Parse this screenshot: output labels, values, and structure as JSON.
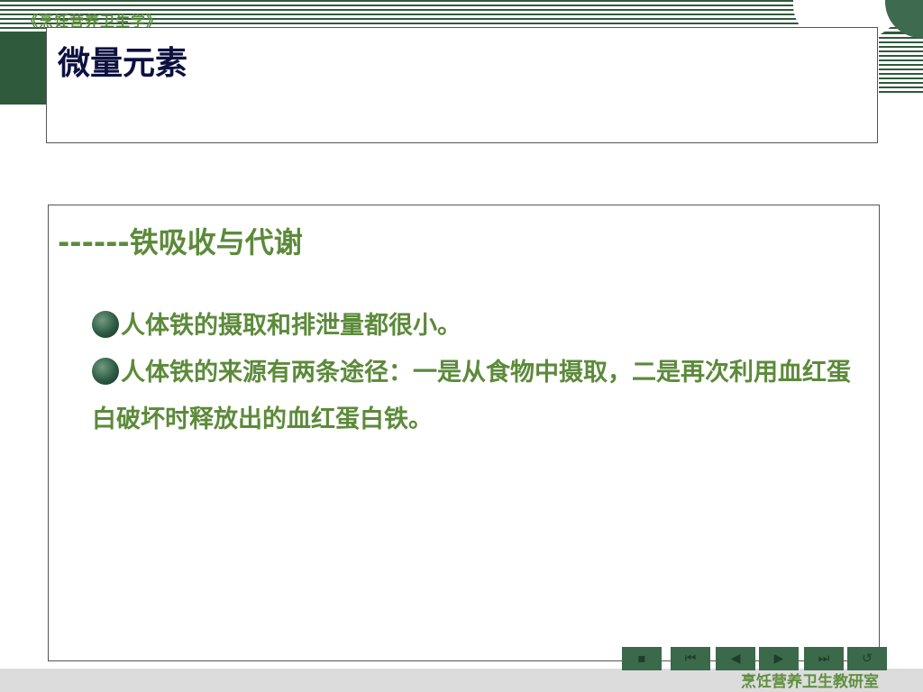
{
  "header": {
    "course_label": "《烹饪营养卫生学》"
  },
  "slide": {
    "title": "微量元素",
    "subtitle": "------铁吸收与代谢",
    "bullets": [
      "人体铁的摄取和排泄量都很小。",
      "人体铁的来源有两条途径：一是从食物中摄取，二是再次利用血红蛋白破坏时释放出的血红蛋白铁。"
    ]
  },
  "footer": {
    "org_label": "烹饪营养卫生教研室"
  },
  "navigation": {
    "buttons": [
      {
        "name": "home-icon",
        "glyph": "▪"
      },
      {
        "name": "first-page-icon",
        "glyph": "⏮"
      },
      {
        "name": "previous-icon",
        "glyph": "◀"
      },
      {
        "name": "next-icon",
        "glyph": "▶"
      },
      {
        "name": "last-page-icon",
        "glyph": "⏭"
      },
      {
        "name": "return-icon",
        "glyph": "↺"
      }
    ]
  },
  "colors": {
    "title": "#0d1140",
    "accent_green": "#5c8a3a",
    "dark_green": "#2f5a3c"
  }
}
